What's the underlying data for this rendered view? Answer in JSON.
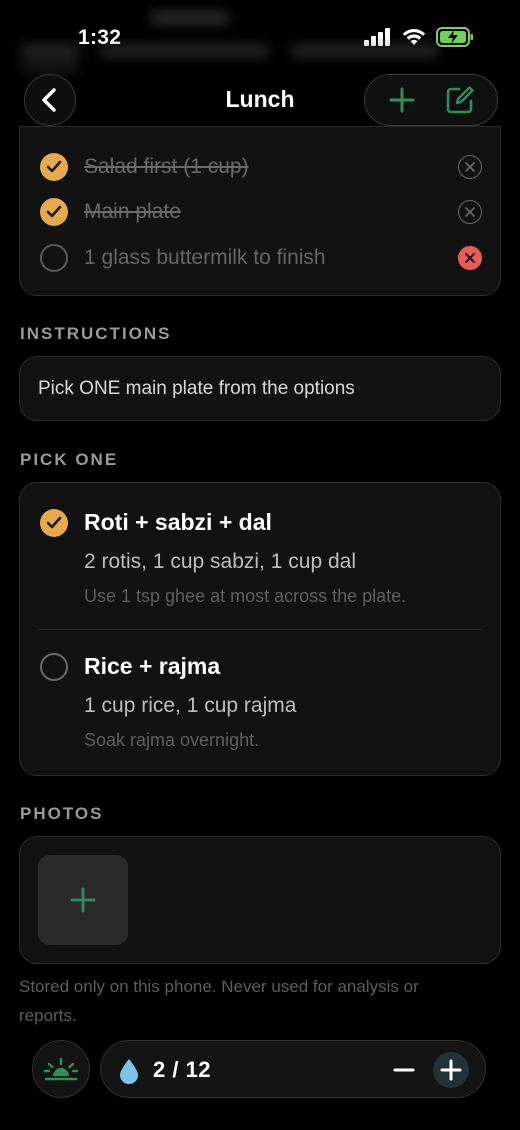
{
  "status_bar": {
    "time": "1:32"
  },
  "nav": {
    "title": "Lunch"
  },
  "checklist": {
    "items": [
      {
        "label": "Salad first (1 cup)",
        "done": true
      },
      {
        "label": "Main plate",
        "done": true
      },
      {
        "label": "1 glass buttermilk to finish",
        "done": false
      }
    ]
  },
  "instructions": {
    "heading": "INSTRUCTIONS",
    "text": "Pick ONE main plate from the options"
  },
  "pick_one": {
    "heading": "PICK ONE",
    "options": [
      {
        "title": "Roti + sabzi + dal",
        "portions": "2 rotis, 1 cup sabzi, 1 cup dal",
        "note": "Use 1 tsp ghee at most across the plate.",
        "selected": true
      },
      {
        "title": "Rice + rajma",
        "portions": "1 cup rice, 1 cup rajma",
        "note": "Soak rajma overnight.",
        "selected": false
      }
    ]
  },
  "photos": {
    "heading": "PHOTOS",
    "note": "Stored only on this phone. Never used for analysis or reports."
  },
  "water": {
    "count": "2 / 12"
  },
  "colors": {
    "accent": "#e7a94e",
    "green": "#2f8f5b",
    "danger": "#e85b5b",
    "background": "#000000",
    "card": "#121212"
  }
}
